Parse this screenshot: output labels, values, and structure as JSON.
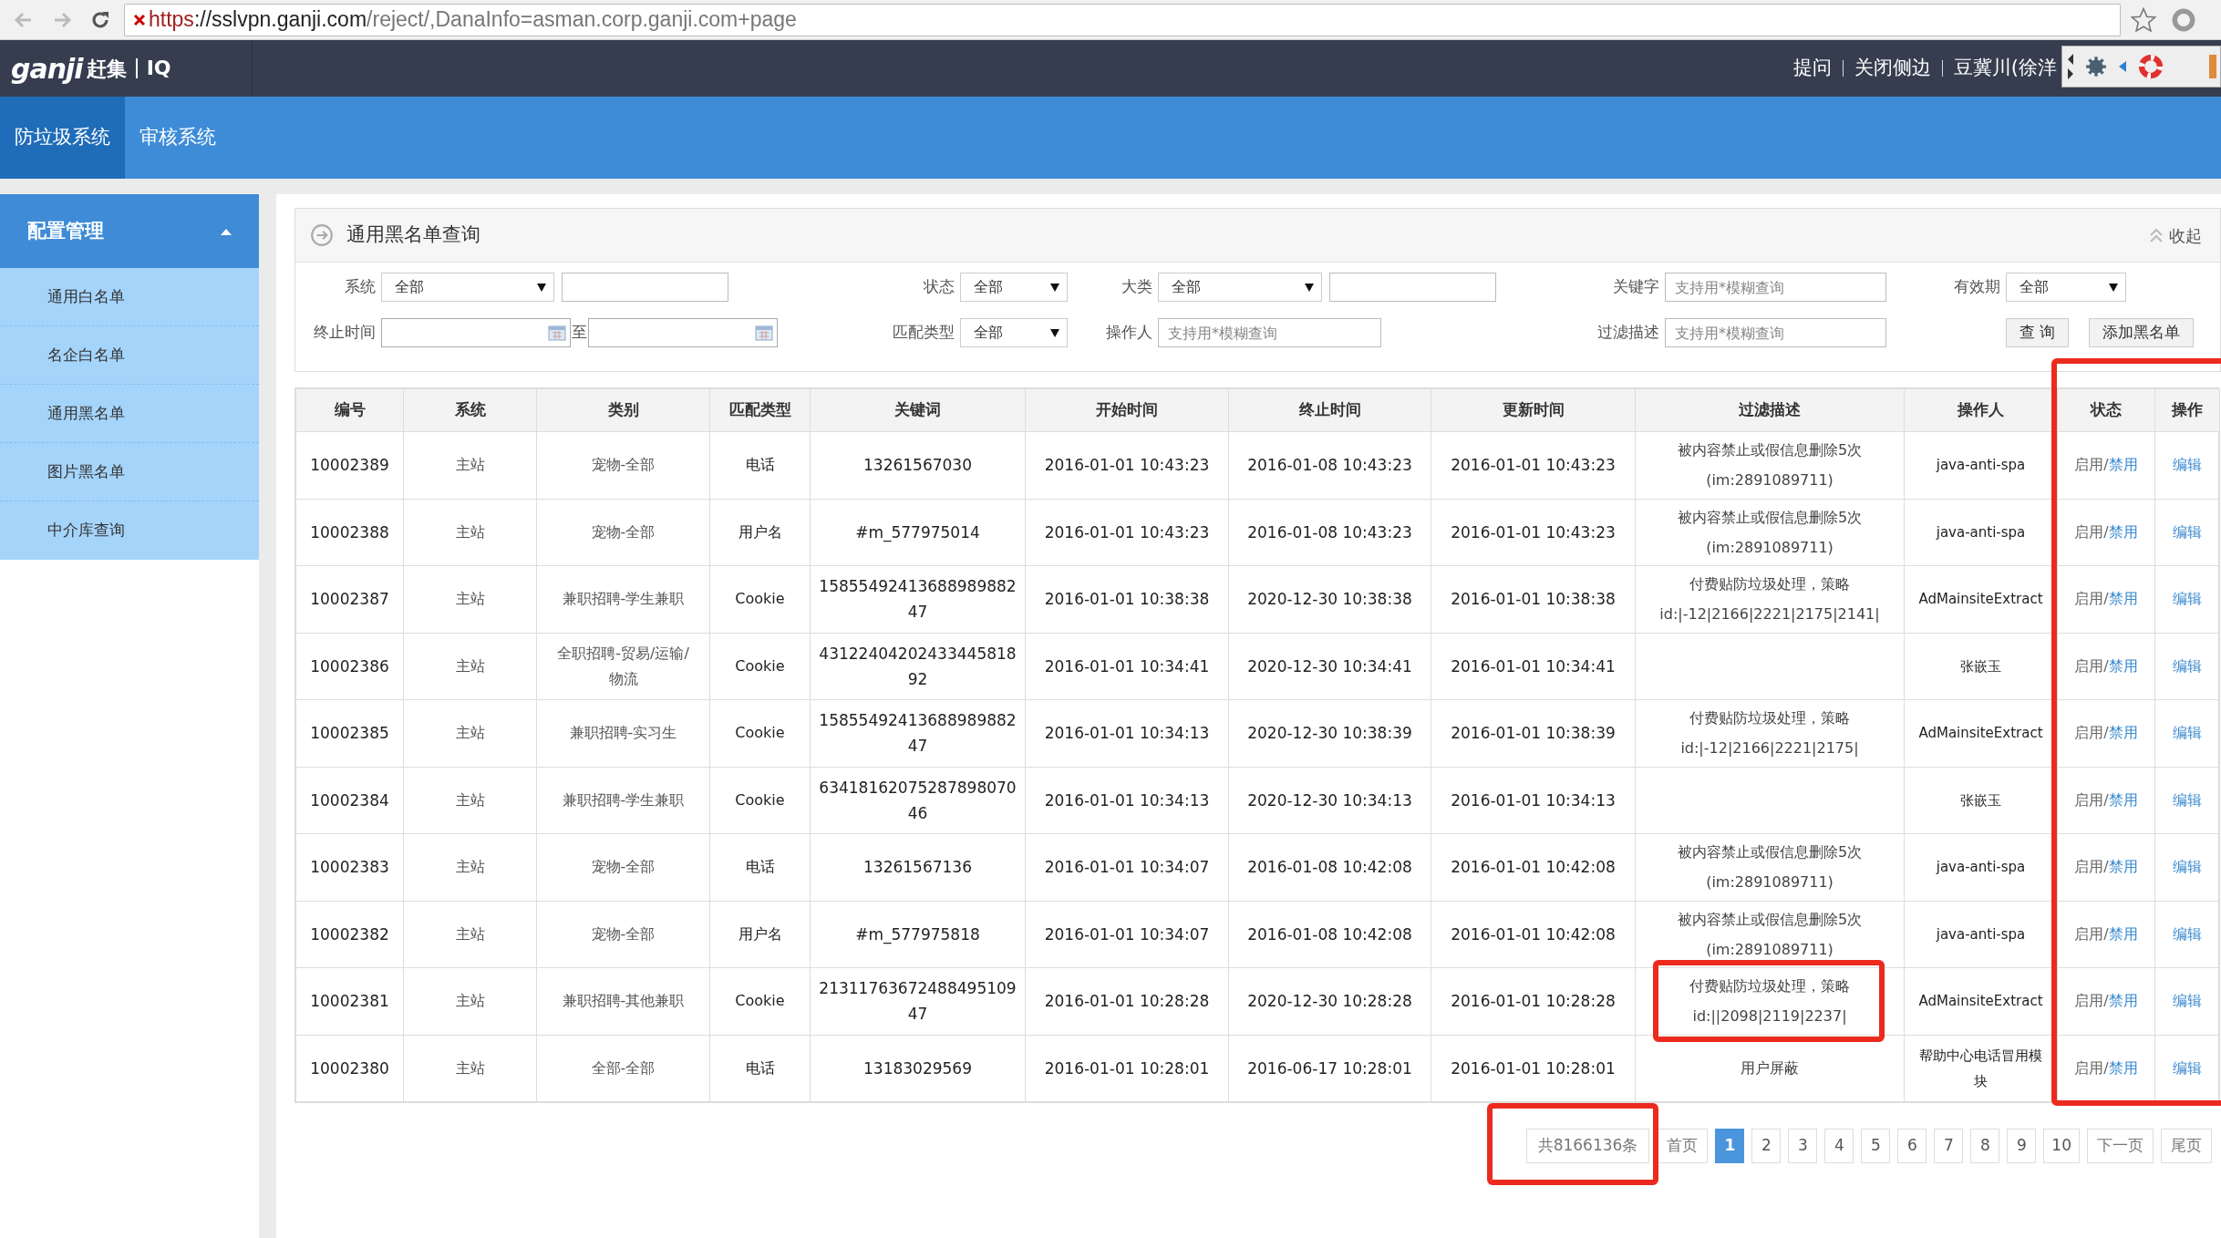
{
  "browser": {
    "insecure": true,
    "scheme": "https",
    "host": "://sslvpn.ganji.com",
    "path": "/reject/,DanaInfo=asman.corp.ganji.com+page"
  },
  "header": {
    "logo": "ganji",
    "logo_cn": "赶集",
    "product": "IQ",
    "links": [
      "提问",
      "关闭侧边",
      "豆冀川(徐洋"
    ]
  },
  "nav_tabs": [
    {
      "label": "防垃圾系统",
      "selected": true
    },
    {
      "label": "审核系统",
      "selected": false
    }
  ],
  "sidebar": {
    "title": "配置管理",
    "expanded": true,
    "items": [
      "通用白名单",
      "名企白名单",
      "通用黑名单",
      "图片黑名单",
      "中介库查询"
    ]
  },
  "panel": {
    "title": "通用黑名单查询",
    "collapse": "收起"
  },
  "filters": [
    [
      {
        "label": "系统",
        "controls": [
          {
            "kind": "select",
            "value": "全部"
          },
          {
            "kind": "text"
          }
        ]
      },
      {
        "label": "状态",
        "controls": [
          {
            "kind": "select",
            "value": "全部"
          }
        ]
      },
      {
        "label": "大类",
        "controls": [
          {
            "kind": "select",
            "value": "全部"
          },
          {
            "kind": "text"
          }
        ]
      },
      {
        "label": "关键字",
        "controls": [
          {
            "kind": "text",
            "placeholder": "支持用*模糊查询"
          }
        ]
      },
      {
        "label": "有效期",
        "controls": [
          {
            "kind": "select",
            "value": "全部"
          }
        ]
      }
    ],
    [
      {
        "label": "终止时间",
        "controls": [
          {
            "kind": "date"
          },
          {
            "kind": "separator",
            "text": "至"
          },
          {
            "kind": "date"
          }
        ]
      },
      {
        "label": "匹配类型",
        "controls": [
          {
            "kind": "select",
            "value": "全部"
          }
        ]
      },
      {
        "label": "操作人",
        "controls": [
          {
            "kind": "text",
            "placeholder": "支持用*模糊查询"
          }
        ]
      },
      {
        "label": "过滤描述",
        "controls": [
          {
            "kind": "text",
            "placeholder": "支持用*模糊查询"
          }
        ]
      },
      {
        "controls": [
          {
            "kind": "button",
            "label": "查 询"
          },
          {
            "kind": "button",
            "label": "添加黑名单"
          }
        ]
      }
    ]
  ],
  "table": {
    "columns": [
      "编号",
      "系统",
      "类别",
      "匹配类型",
      "关键词",
      "开始时间",
      "终止时间",
      "更新时间",
      "过滤描述",
      "操作人",
      "状态",
      "操作"
    ],
    "rows": [
      {
        "id": "10002389",
        "system": "主站",
        "category": "宠物-全部",
        "match_type": "电话",
        "keyword": "13261567030",
        "start": "2016-01-01 10:43:23",
        "end": "2016-01-08 10:43:23",
        "updated": "2016-01-01 10:43:23",
        "description": "被内容禁止或假信息删除5次 (im:2891089711)",
        "operator": "java-anti-spa",
        "status": "启用/",
        "toggle": "禁用",
        "edit": "编辑"
      },
      {
        "id": "10002388",
        "system": "主站",
        "category": "宠物-全部",
        "match_type": "用户名",
        "keyword": "#m_577975014",
        "start": "2016-01-01 10:43:23",
        "end": "2016-01-08 10:43:23",
        "updated": "2016-01-01 10:43:23",
        "description": "被内容禁止或假信息删除5次 (im:2891089711)",
        "operator": "java-anti-spa",
        "status": "启用/",
        "toggle": "禁用",
        "edit": "编辑"
      },
      {
        "id": "10002387",
        "system": "主站",
        "category": "兼职招聘-学生兼职",
        "match_type": "Cookie",
        "keyword": "1585549241368898988247",
        "start": "2016-01-01 10:38:38",
        "end": "2020-12-30 10:38:38",
        "updated": "2016-01-01 10:38:38",
        "description": "付费贴防垃圾处理，策略 id:|-12|2166|2221|2175|2141|",
        "operator": "AdMainsiteExtract",
        "status": "启用/",
        "toggle": "禁用",
        "edit": "编辑"
      },
      {
        "id": "10002386",
        "system": "主站",
        "category": "全职招聘-贸易/运输/物流",
        "match_type": "Cookie",
        "keyword": "4312240420243344581892",
        "start": "2016-01-01 10:34:41",
        "end": "2020-12-30 10:34:41",
        "updated": "2016-01-01 10:34:41",
        "operator": "张嵌玉",
        "status": "启用/",
        "toggle": "禁用",
        "edit": "编辑"
      },
      {
        "id": "10002385",
        "system": "主站",
        "category": "兼职招聘-实习生",
        "match_type": "Cookie",
        "keyword": "1585549241368898988247",
        "start": "2016-01-01 10:34:13",
        "end": "2020-12-30 10:38:39",
        "updated": "2016-01-01 10:38:39",
        "description": "付费贴防垃圾处理，策略 id:|-12|2166|2221|2175|",
        "operator": "AdMainsiteExtract",
        "status": "启用/",
        "toggle": "禁用",
        "edit": "编辑"
      },
      {
        "id": "10002384",
        "system": "主站",
        "category": "兼职招聘-学生兼职",
        "match_type": "Cookie",
        "keyword": "6341816207528789807046",
        "start": "2016-01-01 10:34:13",
        "end": "2020-12-30 10:34:13",
        "updated": "2016-01-01 10:34:13",
        "operator": "张嵌玉",
        "status": "启用/",
        "toggle": "禁用",
        "edit": "编辑"
      },
      {
        "id": "10002383",
        "system": "主站",
        "category": "宠物-全部",
        "match_type": "电话",
        "keyword": "13261567136",
        "start": "2016-01-01 10:34:07",
        "end": "2016-01-08 10:42:08",
        "updated": "2016-01-01 10:42:08",
        "description": "被内容禁止或假信息删除5次 (im:2891089711)",
        "operator": "java-anti-spa",
        "status": "启用/",
        "toggle": "禁用",
        "edit": "编辑"
      },
      {
        "id": "10002382",
        "system": "主站",
        "category": "宠物-全部",
        "match_type": "用户名",
        "keyword": "#m_577975818",
        "start": "2016-01-01 10:34:07",
        "end": "2016-01-08 10:42:08",
        "updated": "2016-01-01 10:42:08",
        "description": "被内容禁止或假信息删除5次 (im:2891089711)",
        "operator": "java-anti-spa",
        "status": "启用/",
        "toggle": "禁用",
        "edit": "编辑"
      },
      {
        "id": "10002381",
        "system": "主站",
        "category": "兼职招聘-其他兼职",
        "match_type": "Cookie",
        "keyword": "2131176367248849510947",
        "start": "2016-01-01 10:28:28",
        "end": "2020-12-30 10:28:28",
        "updated": "2016-01-01 10:28:28",
        "description": "付费贴防垃圾处理，策略 id:||2098|2119|2237|",
        "operator": "AdMainsiteExtract",
        "status": "启用/",
        "toggle": "禁用",
        "edit": "编辑"
      },
      {
        "id": "10002380",
        "system": "主站",
        "category": "全部-全部",
        "match_type": "电话",
        "keyword": "13183029569",
        "start": "2016-01-01 10:28:01",
        "end": "2016-06-17 10:28:01",
        "updated": "2016-01-01 10:28:01",
        "description": "用户屏蔽",
        "operator": "帮助中心电话冒用模块",
        "status": "启用/",
        "toggle": "禁用",
        "edit": "编辑"
      }
    ]
  },
  "pagination": {
    "total": "共8166136条",
    "first": "首页",
    "pages": [
      {
        "label": "1",
        "selected": true
      },
      {
        "label": "2",
        "selected": false
      },
      {
        "label": "3",
        "selected": false
      },
      {
        "label": "4",
        "selected": false
      },
      {
        "label": "5",
        "selected": false
      },
      {
        "label": "6",
        "selected": false
      },
      {
        "label": "7",
        "selected": false
      },
      {
        "label": "8",
        "selected": false
      },
      {
        "label": "9",
        "selected": false
      },
      {
        "label": "10",
        "selected": false
      }
    ],
    "next": "下一页",
    "last": "尾页"
  }
}
